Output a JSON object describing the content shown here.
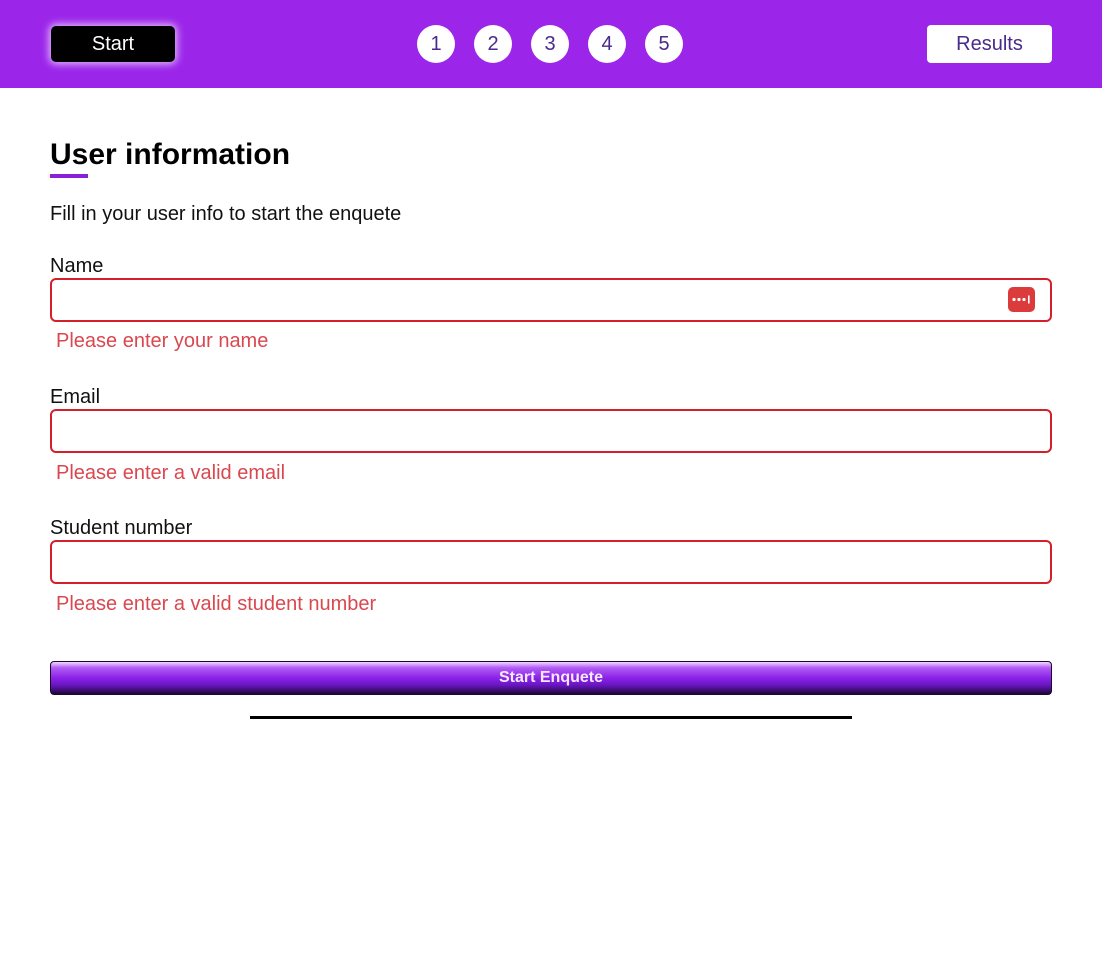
{
  "header": {
    "start_label": "Start",
    "steps": [
      "1",
      "2",
      "3",
      "4",
      "5"
    ],
    "results_label": "Results",
    "bar_color": "#9b26ea"
  },
  "main": {
    "title": "User information",
    "intro": "Fill in your user info to start the enquete",
    "fields": [
      {
        "label": "Name",
        "value": "",
        "error": "Please enter your name"
      },
      {
        "label": "Email",
        "value": "",
        "error": "Please enter a valid email"
      },
      {
        "label": "Student number",
        "value": "",
        "error": "Please enter a valid student number"
      }
    ],
    "submit_label": "Start Enquete"
  },
  "icons": {
    "password_manager": "password-manager-icon"
  },
  "colors": {
    "accent": "#8a1fd8",
    "error": "#d9484f",
    "error_border": "#d4202a"
  }
}
